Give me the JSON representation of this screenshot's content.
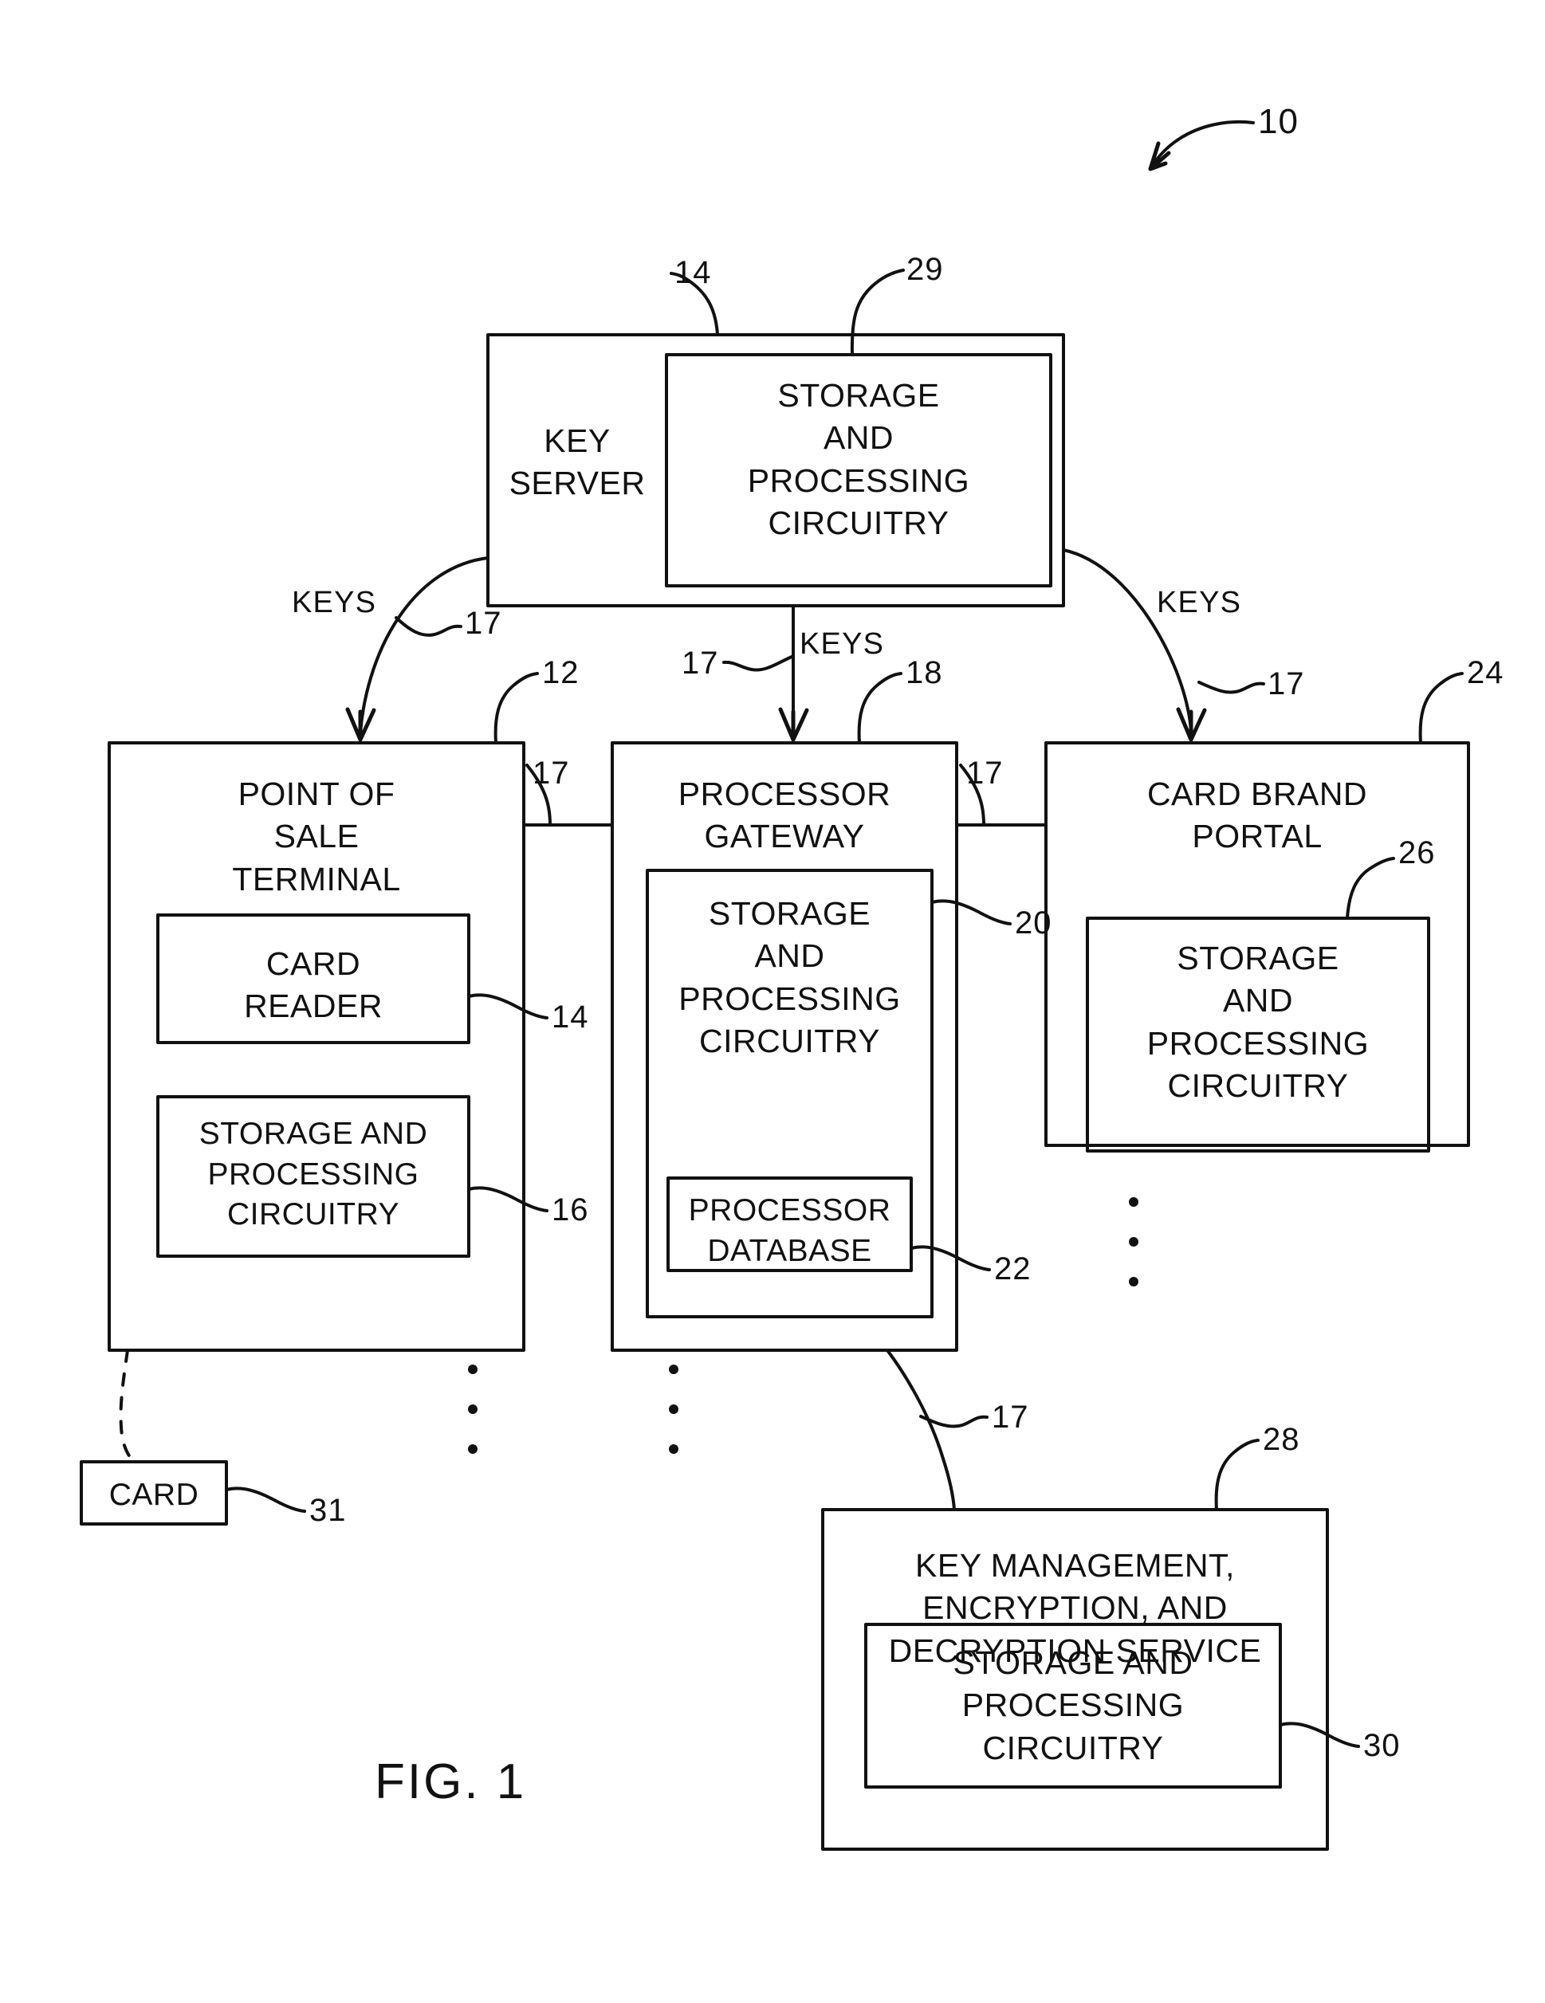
{
  "figure": {
    "caption": "FIG. 1",
    "system_ref": "10"
  },
  "nodes": {
    "key_server": {
      "title": "KEY\nSERVER",
      "ref": "14",
      "inner": {
        "title": "STORAGE\nAND\nPROCESSING\nCIRCUITRY",
        "ref": "29"
      }
    },
    "pos_terminal": {
      "title": "POINT OF\nSALE\nTERMINAL",
      "ref": "12",
      "card_reader": {
        "title": "CARD\nREADER",
        "ref": "14"
      },
      "storage": {
        "title": "STORAGE AND\nPROCESSING\nCIRCUITRY",
        "ref": "16"
      }
    },
    "processor_gateway": {
      "title": "PROCESSOR\nGATEWAY",
      "ref": "18",
      "storage": {
        "title": "STORAGE\nAND\nPROCESSING\nCIRCUITRY",
        "ref": "20"
      },
      "database": {
        "title": "PROCESSOR\nDATABASE",
        "ref": "22"
      }
    },
    "card_brand_portal": {
      "title": "CARD BRAND\nPORTAL",
      "ref": "24",
      "storage": {
        "title": "STORAGE\nAND\nPROCESSING\nCIRCUITRY",
        "ref": "26"
      }
    },
    "key_service": {
      "title": "KEY MANAGEMENT,\nENCRYPTION, AND\nDECRYPTION SERVICE",
      "ref": "28",
      "storage": {
        "title": "STORAGE AND\nPROCESSING\nCIRCUITRY",
        "ref": "30"
      }
    },
    "card": {
      "title": "CARD",
      "ref": "31"
    }
  },
  "connections": {
    "keys_left_label": "KEYS",
    "keys_center_label": "KEYS",
    "keys_right_label": "KEYS",
    "keys_left_ref": "17",
    "keys_center_ref": "17",
    "keys_right_ref": "17",
    "link_pos_gateway_ref": "17",
    "link_gateway_portal_ref": "17",
    "link_gateway_service_ref": "17"
  },
  "colors": {
    "ink": "#111111",
    "paper": "#ffffff"
  }
}
